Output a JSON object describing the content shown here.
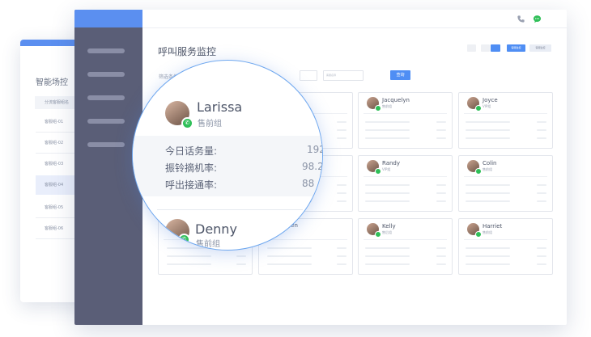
{
  "colors": {
    "accent": "#4f8ef4",
    "sidebar": "#5a5e77",
    "online": "#2fbf58"
  },
  "back_panel": {
    "title": "智能场控",
    "subhead": "分流客服组名",
    "items": [
      "客服组-01",
      "客服组-02",
      "客服组-03",
      "客服组-04",
      "客服组-05",
      "客服组-06"
    ],
    "selected_index": 3
  },
  "header": {
    "phone_icon": "phone-icon",
    "message_icon": "chat-bubble-icon"
  },
  "page": {
    "title": "呼叫服务监控",
    "view_toggles": [
      "客服监控",
      "客服监控"
    ],
    "filter_label": "筛选条件",
    "input_placeholder": "客服名称",
    "query_button": "查询"
  },
  "cards": [
    {
      "name": "Larissa",
      "group": "售前组"
    },
    {
      "name": "",
      "group": ""
    },
    {
      "name": "Jacquelyn",
      "group": "售前组"
    },
    {
      "name": "Joyce",
      "group": "VIP组"
    },
    {
      "name": "",
      "group": ""
    },
    {
      "name": "",
      "group": ""
    },
    {
      "name": "Randy",
      "group": "VIP组"
    },
    {
      "name": "Colin",
      "group": "售前组"
    },
    {
      "name": "Denny",
      "group": "售前组"
    },
    {
      "name": "Aiden",
      "group": "售前组"
    },
    {
      "name": "Kelly",
      "group": "售后组"
    },
    {
      "name": "Harriet",
      "group": "售前组"
    }
  ],
  "magnifier": {
    "name": "Larissa",
    "group": "售前组",
    "stats": [
      {
        "label": "今日话务量:",
        "value": "192"
      },
      {
        "label": "振铃摘机率:",
        "value": "98.2"
      },
      {
        "label": "呼出接通率:",
        "value": "88"
      }
    ],
    "next_name": "Denny",
    "next_group": "售前组",
    "next_partial_name": "Aiden"
  }
}
